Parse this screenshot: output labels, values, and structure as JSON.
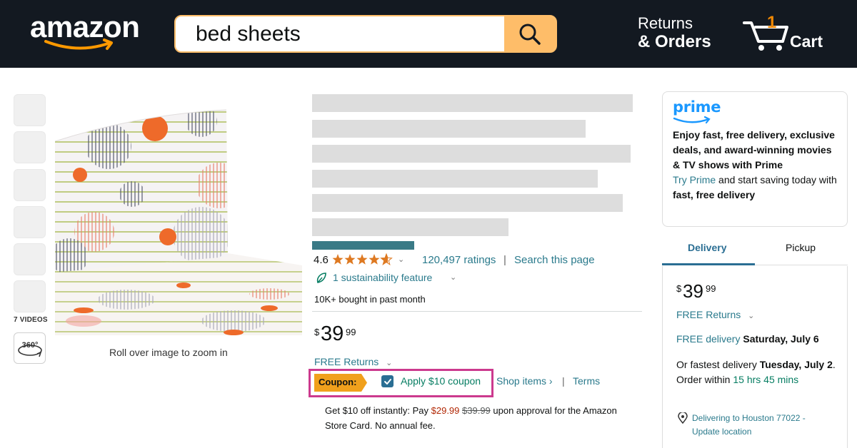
{
  "header": {
    "logo_text": "amazon",
    "search_value": "bed sheets",
    "returns_line1": "Returns",
    "returns_line2": "& Orders",
    "cart_count": "1",
    "cart_label": "Cart"
  },
  "gallery": {
    "videos_label": "7 VIDEOS",
    "spin_label": "360°",
    "zoom_hint": "Roll over image to zoom in"
  },
  "product": {
    "rating": "4.6",
    "stars": 4.6,
    "ratings_count": "120,497 ratings",
    "separator": "|",
    "search_page": "Search this page",
    "sustainability": "1 sustainability feature",
    "bought": "10K+ bought in past month",
    "price_currency": "$",
    "price_whole": "39",
    "price_fraction": "99",
    "free_returns": "FREE Returns",
    "coupon_label": "Coupon:",
    "apply_coupon": "Apply $10 coupon",
    "shop_items": "Shop items ›",
    "terms": "Terms",
    "store_card_pre": "Get $10 off instantly: Pay ",
    "store_card_new_price": "$29.99",
    "store_card_old_price": "$39.99",
    "store_card_post": " upon approval for the Amazon Store Card. No annual fee."
  },
  "prime": {
    "logo": "prime",
    "headline": "Enjoy fast, free delivery, exclusive deals, and award-winning movies & TV shows with Prime",
    "try_prime": "Try Prime",
    "try_rest": " and start saving today with ",
    "fast_free": "fast, free delivery"
  },
  "buybox": {
    "tab_delivery": "Delivery",
    "tab_pickup": "Pickup",
    "price_currency": "$",
    "price_whole": "39",
    "price_fraction": "99",
    "free_returns": "FREE Returns",
    "free_delivery": "FREE delivery",
    "delivery_date": "Saturday, July 6",
    "fastest_pre": "Or fastest delivery ",
    "fastest_date": "Tuesday, July 2",
    "order_within_pre": ". Order within ",
    "order_within_time": "15 hrs 45 mins",
    "location": "Delivering to Houston 77022 - Update location"
  },
  "colors": {
    "header_bg": "#131921",
    "search_button": "#febd69",
    "link_teal": "#2a7a8c",
    "coupon_highlight": "#cc3a8e",
    "coupon_badge": "#f0a01c",
    "green": "#067d62",
    "star": "#de7921",
    "price_red": "#b12704"
  }
}
